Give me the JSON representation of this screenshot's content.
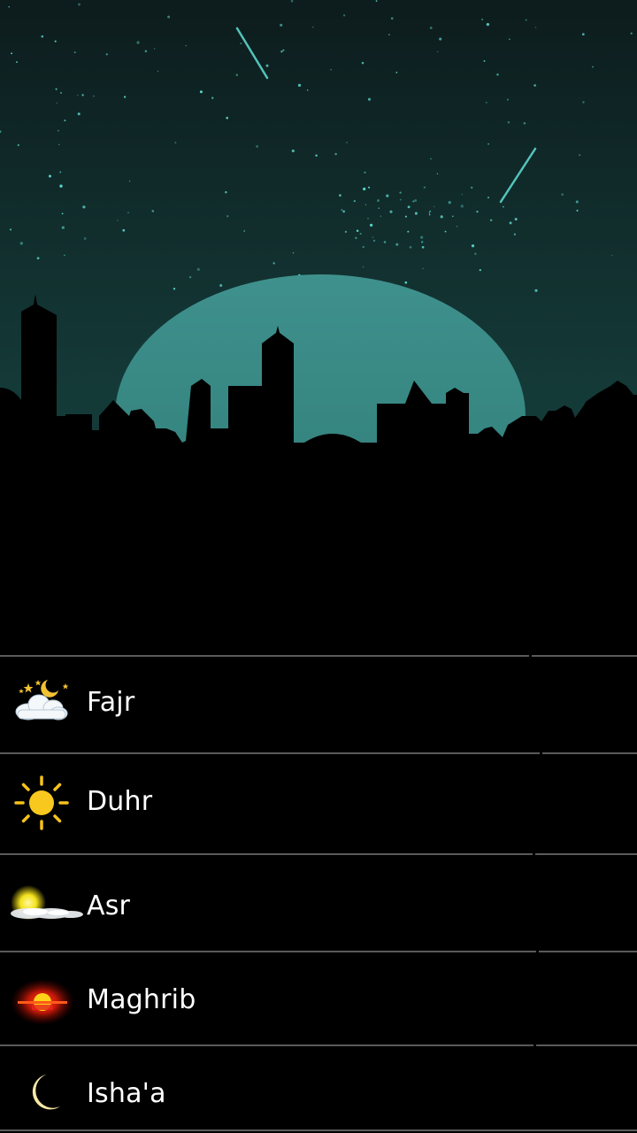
{
  "colors": {
    "sky_top": "#0d1c1d",
    "sky_bottom": "#14403d",
    "moon": "#3b8c88",
    "stars": "#5fe0d6",
    "skyline": "#000000",
    "divider": "#5a5a5a",
    "text": "#ffffff"
  },
  "prayers": [
    {
      "name": "Fajr",
      "icon": "night-cloud-icon"
    },
    {
      "name": "Duhr",
      "icon": "sun-icon"
    },
    {
      "name": "Asr",
      "icon": "sun-behind-cloud-icon"
    },
    {
      "name": "Maghrib",
      "icon": "sunset-icon"
    },
    {
      "name": "Isha'a",
      "icon": "crescent-moon-icon"
    }
  ]
}
